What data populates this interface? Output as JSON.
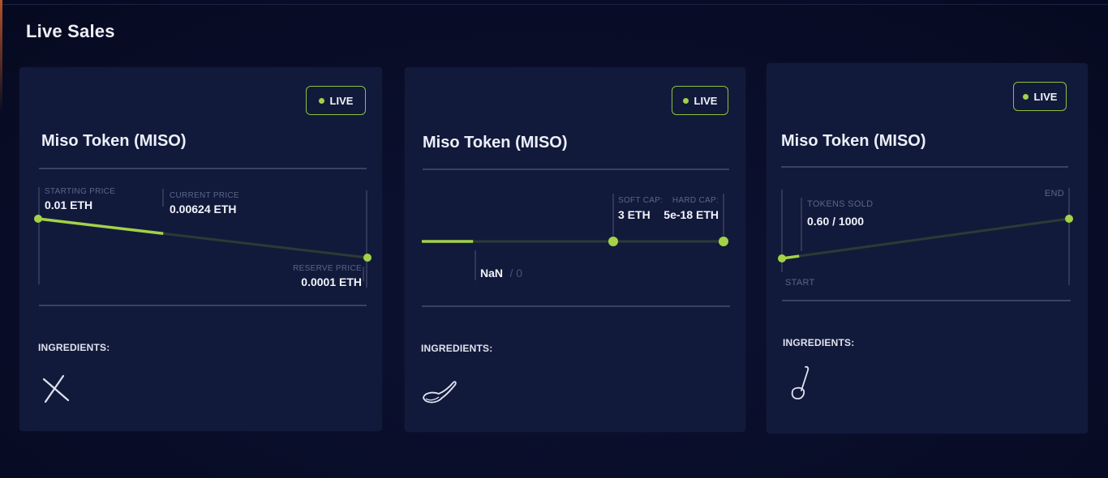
{
  "section": {
    "title": "Live Sales"
  },
  "colors": {
    "accent": "#a3d247",
    "card": "#121a3b",
    "background": "#080c26",
    "track": "#2c3a35"
  },
  "cards": [
    {
      "status": "LIVE",
      "token": "Miso Token (MISO)",
      "type": "dutch-auction",
      "starting_price_label": "STARTING PRICE",
      "starting_price": "0.01 ETH",
      "current_price_label": "CURRENT PRICE",
      "current_price": "0.00624 ETH",
      "reserve_price_label": "RESERVE PRICE",
      "reserve_price": "0.0001 ETH",
      "progress": 0.38,
      "ingredients_label": "INGREDIENTS:",
      "ingredient_icon": "chopsticks-icon"
    },
    {
      "status": "LIVE",
      "token": "Miso Token (MISO)",
      "type": "batch-auction",
      "soft_cap_label": "SOFT CAP:",
      "soft_cap": "3 ETH",
      "hard_cap_label": "HARD CAP:",
      "hard_cap": "5e-18 ETH",
      "raised": "NaN",
      "raised_total": "/ 0",
      "progress": 0.17,
      "ingredients_label": "INGREDIENTS:",
      "ingredient_icon": "soup-spoon-icon"
    },
    {
      "status": "LIVE",
      "token": "Miso Token (MISO)",
      "type": "crowdsale",
      "tokens_sold_label": "TOKENS SOLD",
      "tokens_sold": "0.60 / 1000",
      "start_label": "START",
      "end_label": "END",
      "progress": 0.06,
      "ingredients_label": "INGREDIENTS:",
      "ingredient_icon": "ladle-icon"
    }
  ]
}
